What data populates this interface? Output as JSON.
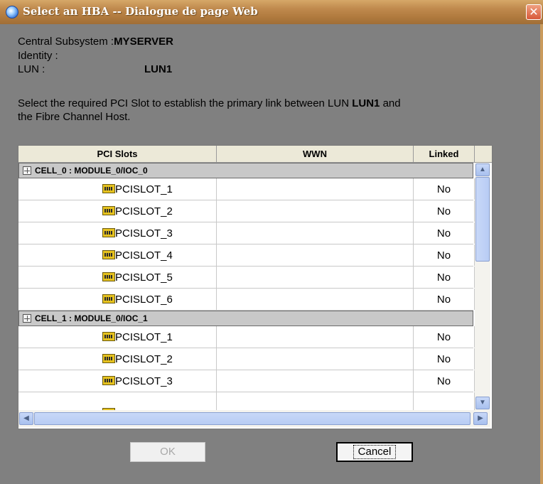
{
  "window": {
    "title": "Select an HBA -- Dialogue de page Web",
    "close_glyph": "✕"
  },
  "info": {
    "subsystem_label": "Central Subsystem :",
    "subsystem_value": "MYSERVER",
    "identity_label": "Identity :",
    "lun_label": "LUN :",
    "lun_value": "LUN1",
    "instruction_part1": "Select the required PCI Slot to establish the primary link between LUN",
    "instruction_lun": "LUN1",
    "instruction_part2": "and",
    "instruction_line2": "the Fibre Channel Host."
  },
  "table": {
    "columns": [
      "PCI Slots",
      "WWN",
      "Linked"
    ],
    "groups": [
      {
        "label": "CELL_0 : MODULE_0/IOC_0",
        "rows": [
          {
            "slot": "PCISLOT_1",
            "wwn": "",
            "linked": "No"
          },
          {
            "slot": "PCISLOT_2",
            "wwn": "",
            "linked": "No"
          },
          {
            "slot": "PCISLOT_3",
            "wwn": "",
            "linked": "No"
          },
          {
            "slot": "PCISLOT_4",
            "wwn": "",
            "linked": "No"
          },
          {
            "slot": "PCISLOT_5",
            "wwn": "",
            "linked": "No"
          },
          {
            "slot": "PCISLOT_6",
            "wwn": "",
            "linked": "No"
          }
        ]
      },
      {
        "label": "CELL_1 : MODULE_0/IOC_1",
        "rows": [
          {
            "slot": "PCISLOT_1",
            "wwn": "",
            "linked": "No"
          },
          {
            "slot": "PCISLOT_2",
            "wwn": "",
            "linked": "No"
          },
          {
            "slot": "PCISLOT_3",
            "wwn": "",
            "linked": "No"
          }
        ]
      }
    ]
  },
  "buttons": {
    "ok": "OK",
    "cancel": "Cancel"
  },
  "colors": {
    "titlebar": "#c08a4e",
    "dialog_background": "#808080",
    "group_row": "#c8c8c8",
    "scrollbar_thumb": "#b8ccf4"
  }
}
